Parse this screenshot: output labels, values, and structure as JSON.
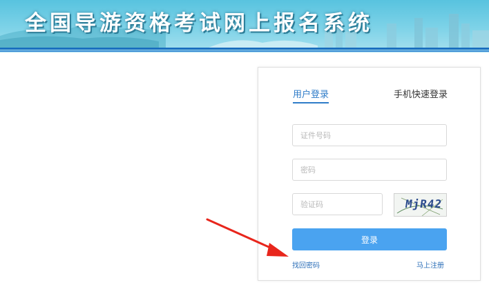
{
  "header": {
    "title": "全国导游资格考试网上报名系统",
    "colors": {
      "sky": "#58c3df",
      "rule": "#1b6fbf"
    }
  },
  "login": {
    "tabs": [
      {
        "label": "用户登录",
        "active": true
      },
      {
        "label": "手机快速登录",
        "active": false
      }
    ],
    "id_placeholder": "证件号码",
    "password_placeholder": "密码",
    "captcha_placeholder": "验证码",
    "captcha_text": "MjR42",
    "submit_label": "登录",
    "forgot_label": "找回密码",
    "register_label": "马上注册",
    "colors": {
      "accent": "#2d7bc8",
      "button": "#4aa3f0"
    }
  },
  "annotation": {
    "arrow_color": "#e8261c"
  }
}
